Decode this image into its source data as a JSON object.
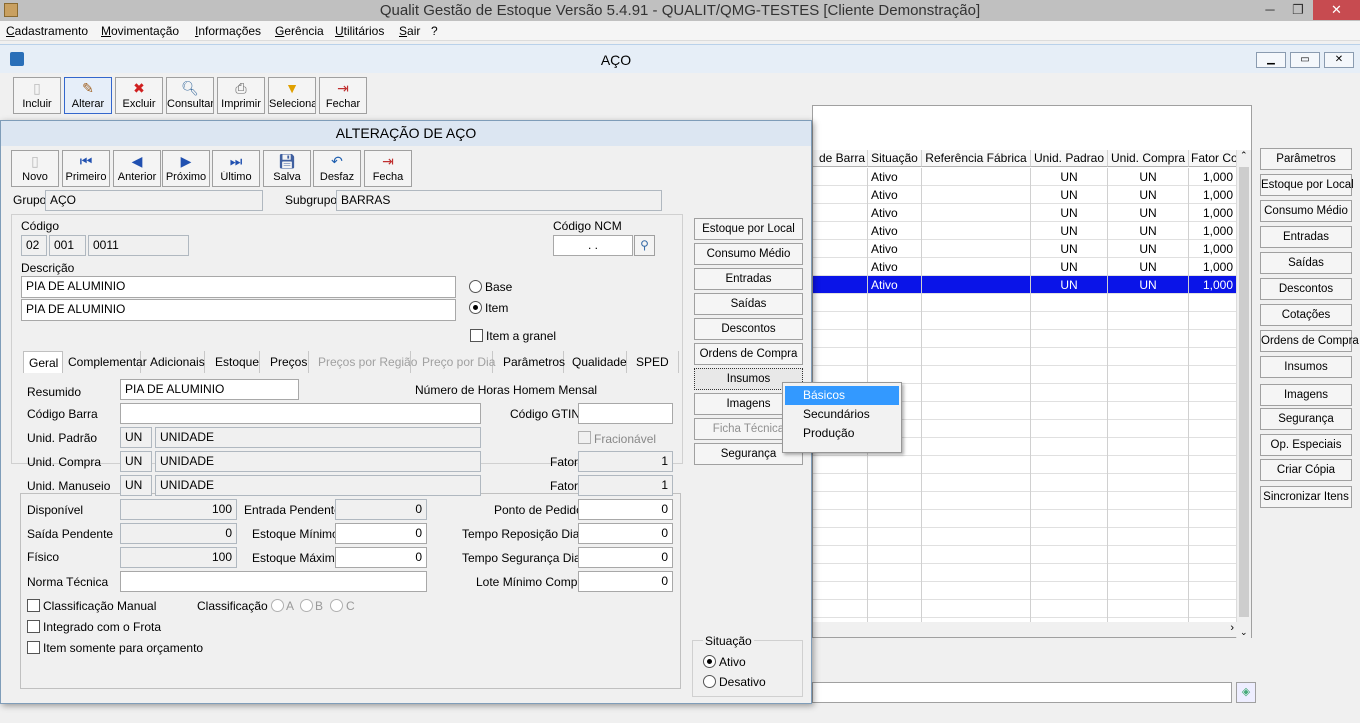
{
  "app": {
    "title": "Qualit Gestão de Estoque Versão 5.4.91 - QUALIT/QMG-TESTES [Cliente Demonstração]"
  },
  "menu": [
    "Cadastramento",
    "Movimentação",
    "Informações",
    "Gerência",
    "Utilitários",
    "Sair",
    "?"
  ],
  "aco": {
    "title": "AÇO",
    "toolbar": [
      "Incluir",
      "Alterar",
      "Excluir",
      "Consultar",
      "Imprimir",
      "Seleciona",
      "Fechar"
    ],
    "grid": {
      "headers": [
        "de Barra",
        "Situação",
        "Referência Fábrica",
        "Unid. Padrao",
        "Unid. Compra",
        "Fator Co"
      ],
      "rows": [
        [
          "",
          "Ativo",
          "",
          "UN",
          "UN",
          "1,000"
        ],
        [
          "",
          "Ativo",
          "",
          "UN",
          "UN",
          "1,000"
        ],
        [
          "",
          "Ativo",
          "",
          "UN",
          "UN",
          "1,000"
        ],
        [
          "",
          "Ativo",
          "",
          "UN",
          "UN",
          "1,000"
        ],
        [
          "",
          "Ativo",
          "",
          "UN",
          "UN",
          "1,000"
        ],
        [
          "",
          "Ativo",
          "",
          "UN",
          "UN",
          "1,000"
        ],
        [
          "",
          "Ativo",
          "",
          "UN",
          "UN",
          "1,000"
        ]
      ]
    },
    "right_buttons": [
      "Parâmetros",
      "Estoque por Local",
      "Consumo Médio",
      "Entradas",
      "Saídas",
      "Descontos",
      "Cotações",
      "Ordens de Compra",
      "Insumos",
      "Imagens",
      "Segurança",
      "Op. Especiais",
      "Criar Cópia",
      "Sincronizar Itens"
    ]
  },
  "dialog": {
    "title": "ALTERAÇÃO DE AÇO",
    "toolbar": [
      "Novo",
      "Primeiro",
      "Anterior",
      "Próximo",
      "Último",
      "Salva",
      "Desfaz",
      "Fecha"
    ],
    "grupo_label": "Grupo",
    "grupo": "AÇO",
    "subgrupo_label": "Subgrupo",
    "subgrupo": "BARRAS",
    "codigo_label": "Código",
    "codigo": [
      "02",
      "001",
      "0011"
    ],
    "ncm_label": "Código NCM",
    "ncm": ". .",
    "descricao_label": "Descrição",
    "descricao1": "PIA DE ALUMINIO",
    "descricao2": "PIA DE ALUMINIO",
    "radio_base": "Base",
    "radio_item": "Item",
    "item_granel": "Item a granel",
    "tabs": [
      "Geral",
      "Complementar",
      "Adicionais",
      "Estoque",
      "Preços",
      "Preços por Região",
      "Preço por Dia",
      "Parâmetros",
      "Qualidade",
      "SPED"
    ],
    "geral": {
      "resumido_label": "Resumido",
      "resumido": "PIA DE ALUMINIO",
      "horas_label": "Número de Horas Homem Mensal",
      "codbarra_label": "Código Barra",
      "codbarra": "",
      "gtin_label": "Código GTIN",
      "gtin": "",
      "unid_padrao_label": "Unid. Padrão",
      "unid_padrao": "UN",
      "unid_padrao_desc": "UNIDADE",
      "fracionavel": "Fracionável",
      "unid_compra_label": "Unid. Compra",
      "unid_compra": "UN",
      "unid_compra_desc": "UNIDADE",
      "fator_label": "Fator",
      "fator_compra": "1",
      "unid_manuseio_label": "Unid. Manuseio",
      "unid_manuseio": "UN",
      "unid_manuseio_desc": "UNIDADE",
      "fator_manuseio": "1",
      "disponivel_label": "Disponível",
      "disponivel": "100",
      "entrada_pendente_label": "Entrada Pendente",
      "entrada_pendente": "0",
      "ponto_pedido_label": "Ponto de Pedido",
      "ponto_pedido": "0",
      "saida_pendente_label": "Saída Pendente",
      "saida_pendente": "0",
      "estoque_minimo_label": "Estoque Mínimo",
      "estoque_minimo": "0",
      "tempo_reposicao_label": "Tempo Reposição Dias",
      "tempo_reposicao": "0",
      "fisico_label": "Físico",
      "fisico": "100",
      "estoque_maximo_label": "Estoque Máximo",
      "estoque_maximo": "0",
      "tempo_seguranca_label": "Tempo Segurança Dias",
      "tempo_seguranca": "0",
      "norma_label": "Norma Técnica",
      "norma": "",
      "lote_label": "Lote Mínimo Compra",
      "lote": "0",
      "classif_manual": "Classificação Manual",
      "classif_label": "Classificação",
      "classif_opts": [
        "A",
        "B",
        "C"
      ],
      "integrado_frota": "Integrado com o Frota",
      "item_orcamento": "Item somente para orçamento"
    },
    "side_buttons": [
      "Estoque por Local",
      "Consumo Médio",
      "Entradas",
      "Saídas",
      "Descontos",
      "Ordens de Compra",
      "Insumos",
      "Imagens",
      "Ficha Técnica",
      "Segurança"
    ],
    "situacao_label": "Situação",
    "situacao_ativo": "Ativo",
    "situacao_desativo": "Desativo"
  },
  "context_menu": [
    "Básicos",
    "Secundários",
    "Produção"
  ]
}
